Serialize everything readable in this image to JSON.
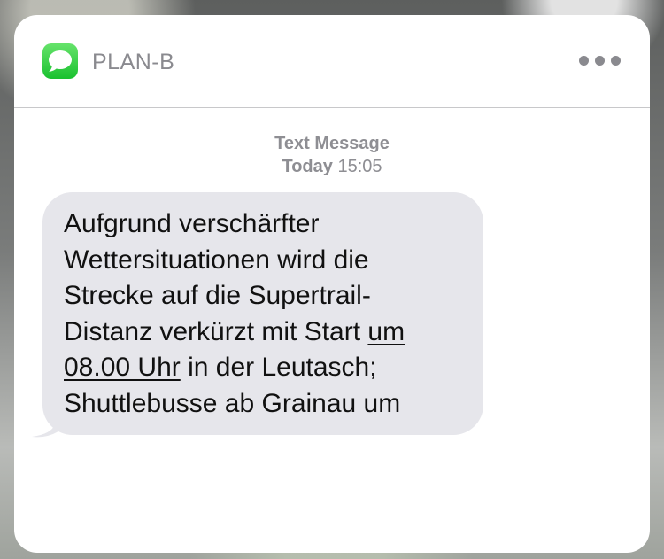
{
  "header": {
    "app_name": "PLAN-B",
    "app_icon": "messages-icon",
    "more_icon": "ellipsis-icon"
  },
  "message_meta": {
    "type_label": "Text Message",
    "day_label": "Today",
    "time": "15:05"
  },
  "message": {
    "line_1": "Aufgrund verschärfter",
    "line_2": "Wettersituationen wird die",
    "line_3": "Strecke auf die Supertrail-",
    "line_4_prefix": "Distanz verkürzt mit Start ",
    "link_part_1": "um",
    "link_part_2": "08.00 Uhr",
    "line_5_suffix": " in der Leutasch;",
    "line_6": "Shuttlebusse ab Grainau um"
  },
  "colors": {
    "icon_green": "#19c12f",
    "bubble_gray": "#e6e6eb",
    "meta_gray": "#8e8e93"
  }
}
